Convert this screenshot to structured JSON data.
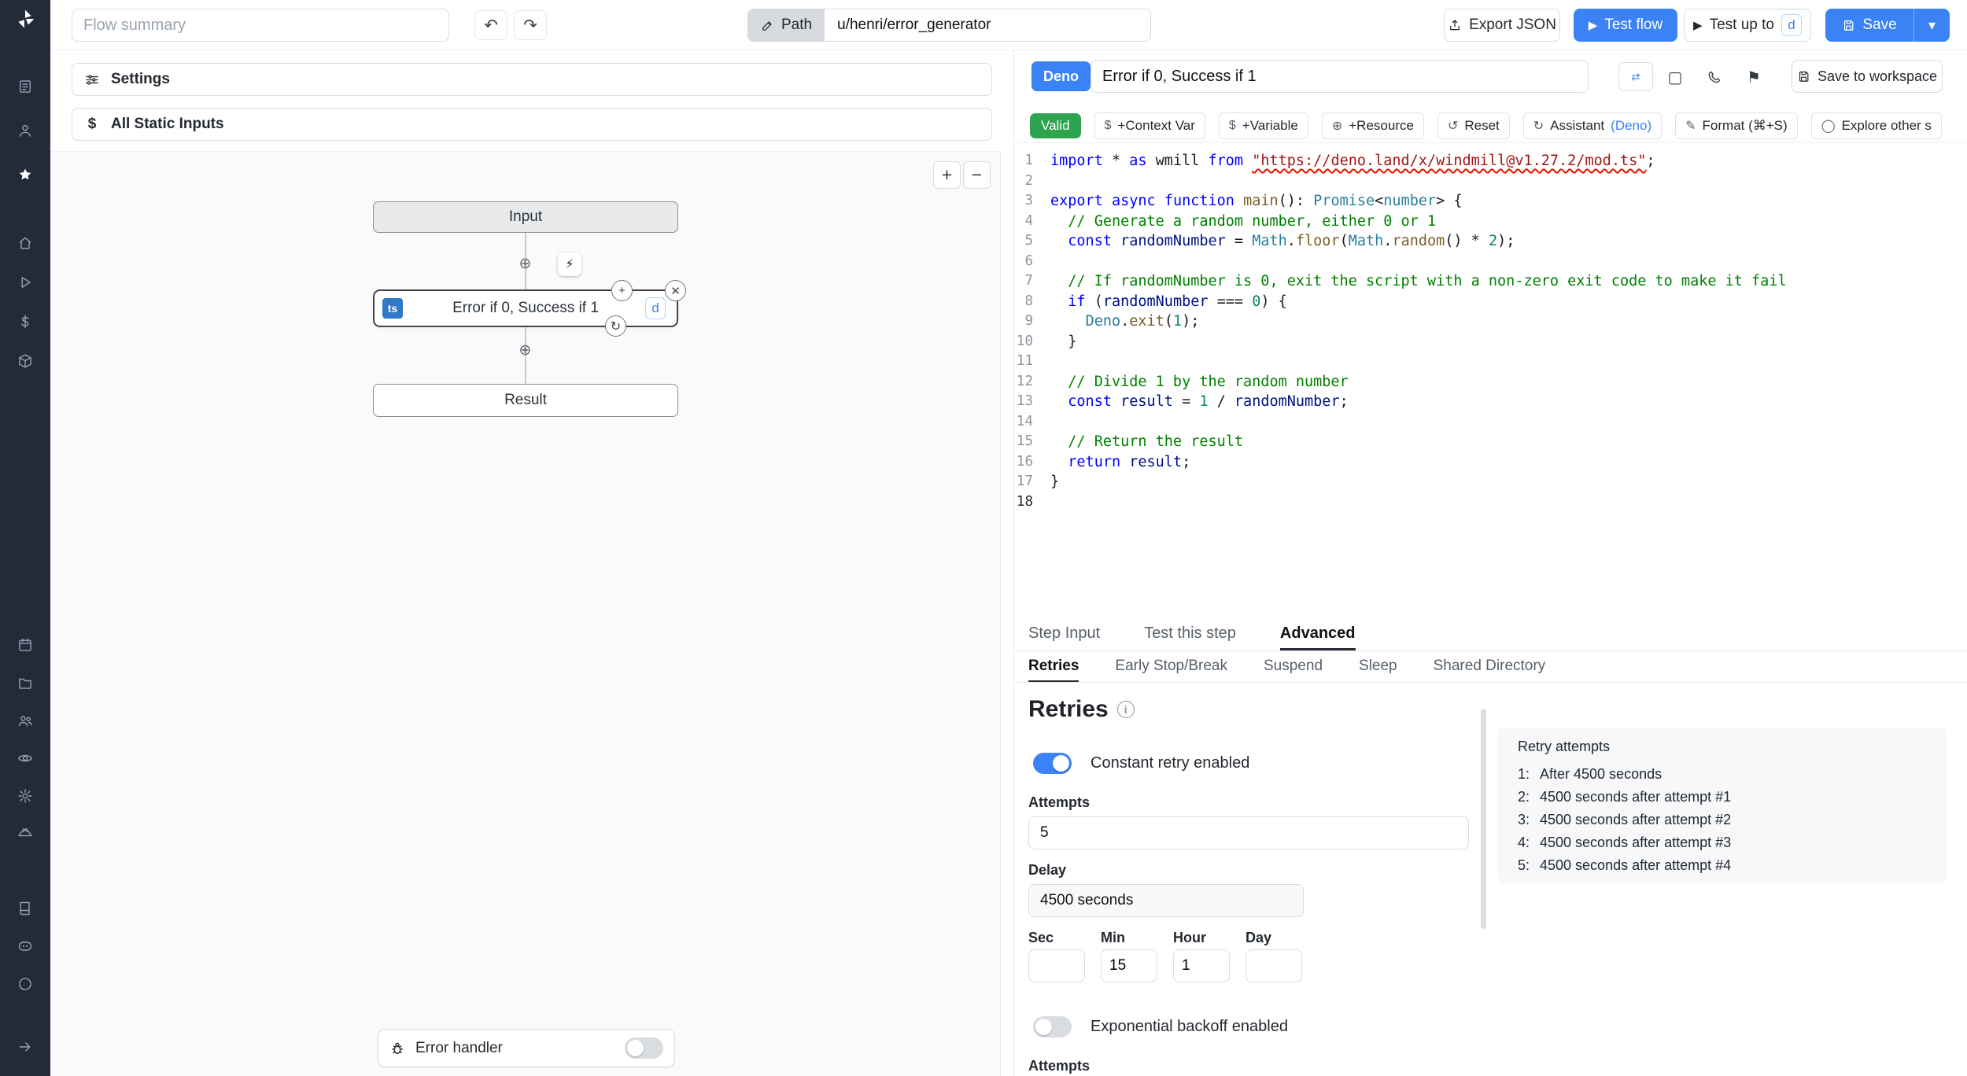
{
  "colors": {
    "accent": "#3b82f6",
    "valid_green": "#2ea44f",
    "sidebar_bg": "#242b38",
    "ts_blue": "#3178c6"
  },
  "sidebar": {
    "icons": [
      "windmill-logo",
      "runs-icon",
      "user-icon",
      "star-icon",
      "home-icon",
      "play-icon",
      "dollar-icon",
      "cube-icon",
      "calendar-icon",
      "folder-icon",
      "users-icon",
      "eye-icon",
      "gear-icon",
      "helmet-icon",
      "book-icon",
      "discord-icon",
      "github-icon",
      "expand-icon"
    ]
  },
  "topbar": {
    "flow_summary_placeholder": "Flow summary",
    "undo_icon": "↶",
    "redo_icon": "↷",
    "path_label": "Path",
    "path_value": "u/henri/error_generator",
    "export_json": "Export JSON",
    "test_flow": "Test flow",
    "test_up_to": "Test up to",
    "test_up_to_badge": "d",
    "save": "Save",
    "save_caret_icon": "▾",
    "play_icon": "▶"
  },
  "flow_panel": {
    "settings_label": "Settings",
    "static_inputs_icon": "$",
    "static_inputs_label": "All Static Inputs",
    "zoom_in": "+",
    "zoom_out": "−",
    "input_node": "Input",
    "step_node": {
      "lang_badge": "ts",
      "title": "Error if 0, Success if 1",
      "id_badge": "d"
    },
    "result_node": "Result",
    "connector_plus": "+",
    "bolt_icon": "⚡",
    "node_plus_icon": "+",
    "node_close_icon": "✕",
    "node_refresh_icon": "↻",
    "error_handler_label": "Error handler"
  },
  "editor_panel": {
    "lang_badge": "Deno",
    "step_name": "Error if 0, Success if 1",
    "swap_icon": "⇄",
    "square_icon": "▢",
    "flag_icon": "⚑",
    "save_to_workspace": "Save to workspace",
    "toolbar": {
      "valid": "Valid",
      "items": [
        {
          "name": "context-var",
          "icon": "$",
          "label": "+Context Var"
        },
        {
          "name": "variable",
          "icon": "$",
          "label": "+Variable"
        },
        {
          "name": "resource",
          "icon": "⊕",
          "label": "+Resource"
        },
        {
          "name": "reset",
          "icon": "↺",
          "label": "Reset"
        },
        {
          "name": "assistant",
          "icon": "↻",
          "label": "Assistant",
          "suffix": "(Deno)"
        },
        {
          "name": "format",
          "icon": "✎",
          "label": "Format (⌘+S)"
        },
        {
          "name": "explore",
          "icon": "◯",
          "label": "Explore other s"
        }
      ]
    },
    "code": {
      "active_line": 18,
      "lines": [
        [
          [
            "k",
            "import"
          ],
          [
            "d",
            " * "
          ],
          [
            "k",
            "as"
          ],
          [
            "d",
            " wmill "
          ],
          [
            "k",
            "from"
          ],
          [
            "d",
            " "
          ],
          [
            "su",
            "\"https://deno.land/x/windmill@v1.27.2/mod.ts\""
          ],
          [
            "d",
            ";"
          ]
        ],
        [],
        [
          [
            "k",
            "export"
          ],
          [
            "d",
            " "
          ],
          [
            "k",
            "async"
          ],
          [
            "d",
            " "
          ],
          [
            "k",
            "function"
          ],
          [
            "d",
            " "
          ],
          [
            "f",
            "main"
          ],
          [
            "d",
            "(): "
          ],
          [
            "t",
            "Promise"
          ],
          [
            "d",
            "<"
          ],
          [
            "t",
            "number"
          ],
          [
            "d",
            "> {"
          ]
        ],
        [
          [
            "c",
            "  // Generate a random number, either 0 or 1"
          ]
        ],
        [
          [
            "k",
            "  const"
          ],
          [
            "d",
            " "
          ],
          [
            "v",
            "randomNumber"
          ],
          [
            "d",
            " = "
          ],
          [
            "t",
            "Math"
          ],
          [
            "d",
            "."
          ],
          [
            "f",
            "floor"
          ],
          [
            "d",
            "("
          ],
          [
            "t",
            "Math"
          ],
          [
            "d",
            "."
          ],
          [
            "f",
            "random"
          ],
          [
            "d",
            "() * "
          ],
          [
            "n",
            "2"
          ],
          [
            "d",
            ");"
          ]
        ],
        [],
        [
          [
            "c",
            "  // If randomNumber is 0, exit the script with a non-zero exit code to make it fail"
          ]
        ],
        [
          [
            "k",
            "  if"
          ],
          [
            "d",
            " ("
          ],
          [
            "v",
            "randomNumber"
          ],
          [
            "d",
            " === "
          ],
          [
            "n",
            "0"
          ],
          [
            "d",
            ") {"
          ]
        ],
        [
          [
            "d",
            "    "
          ],
          [
            "t",
            "Deno"
          ],
          [
            "d",
            "."
          ],
          [
            "f",
            "exit"
          ],
          [
            "d",
            "("
          ],
          [
            "n",
            "1"
          ],
          [
            "d",
            ");"
          ]
        ],
        [
          [
            "d",
            "  }"
          ]
        ],
        [],
        [
          [
            "c",
            "  // Divide 1 by the random number"
          ]
        ],
        [
          [
            "k",
            "  const"
          ],
          [
            "d",
            " "
          ],
          [
            "v",
            "result"
          ],
          [
            "d",
            " = "
          ],
          [
            "n",
            "1"
          ],
          [
            "d",
            " / "
          ],
          [
            "v",
            "randomNumber"
          ],
          [
            "d",
            ";"
          ]
        ],
        [],
        [
          [
            "c",
            "  // Return the result"
          ]
        ],
        [
          [
            "k",
            "  return"
          ],
          [
            "d",
            " "
          ],
          [
            "v",
            "result"
          ],
          [
            "d",
            ";"
          ]
        ],
        [
          [
            "d",
            "}"
          ]
        ],
        []
      ]
    }
  },
  "step_tabs": {
    "items": [
      "Step Input",
      "Test this step",
      "Advanced"
    ],
    "active": "Advanced"
  },
  "advanced_subtabs": {
    "items": [
      "Retries",
      "Early Stop/Break",
      "Suspend",
      "Sleep",
      "Shared Directory"
    ],
    "active": "Retries"
  },
  "retries": {
    "title": "Retries",
    "info_icon": "i",
    "constant_toggle_label": "Constant retry enabled",
    "constant_toggle_on": true,
    "attempts_label": "Attempts",
    "attempts_value": "5",
    "delay_label": "Delay",
    "delay_value": "4500 seconds",
    "time_fields": [
      {
        "label": "Sec",
        "value": ""
      },
      {
        "label": "Min",
        "value": "15"
      },
      {
        "label": "Hour",
        "value": "1"
      },
      {
        "label": "Day",
        "value": ""
      }
    ],
    "exponential_toggle_label": "Exponential backoff enabled",
    "exponential_toggle_on": false,
    "attempts_cutoff_label": "Attempts",
    "retry_attempts_box": {
      "title": "Retry attempts",
      "items": [
        {
          "n": "1:",
          "text": "After 4500 seconds"
        },
        {
          "n": "2:",
          "text": "4500 seconds after attempt #1"
        },
        {
          "n": "3:",
          "text": "4500 seconds after attempt #2"
        },
        {
          "n": "4:",
          "text": "4500 seconds after attempt #3"
        },
        {
          "n": "5:",
          "text": "4500 seconds after attempt #4"
        }
      ]
    }
  }
}
